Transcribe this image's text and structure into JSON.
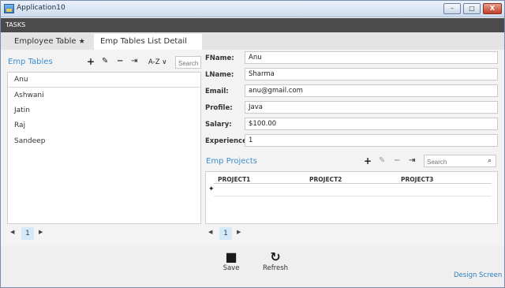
{
  "window": {
    "title": "Application10",
    "controls": {
      "minimize": "–",
      "maximize": "□",
      "close": "X"
    }
  },
  "tasks_bar": {
    "label": "TASKS"
  },
  "tabs": [
    {
      "label": "Employee Table",
      "pin_icon": "★"
    },
    {
      "label": "Emp Tables List Detail"
    }
  ],
  "left_panel": {
    "title": "Emp Tables",
    "tools": {
      "add": "+",
      "edit": "✎",
      "remove": "−",
      "export": "⇥"
    },
    "sort_label": "A-Z",
    "sort_chevron": "∨",
    "search_placeholder": "Search",
    "items": [
      "Anu",
      "Ashwani",
      "Jatin",
      "Raj",
      "Sandeep"
    ],
    "pager": {
      "prev": "◀",
      "page": "1",
      "next": "▶"
    }
  },
  "detail": {
    "fields": [
      {
        "label": "FName:",
        "value": "Anu"
      },
      {
        "label": "LName:",
        "value": "Sharma"
      },
      {
        "label": "Email:",
        "value": "anu@gmail.com"
      },
      {
        "label": "Profile:",
        "value": "Java"
      },
      {
        "label": "Salary:",
        "value": "$100.00"
      },
      {
        "label": "Experience:",
        "value": "1"
      }
    ]
  },
  "projects": {
    "title": "Emp Projects",
    "tools": {
      "add": "+",
      "edit": "✎",
      "remove": "−",
      "export": "⇥"
    },
    "search_placeholder": "Search",
    "search_icon": "⌕",
    "columns": [
      "PROJECT1",
      "PROJECT2",
      "PROJECT3"
    ],
    "new_row_icon": "✦",
    "pager": {
      "prev": "◀",
      "page": "1",
      "next": "▶"
    }
  },
  "footer": {
    "save_label": "Save",
    "save_icon": "■",
    "refresh_label": "Refresh",
    "refresh_icon": "↻",
    "design_screen_label": "Design Screen"
  }
}
